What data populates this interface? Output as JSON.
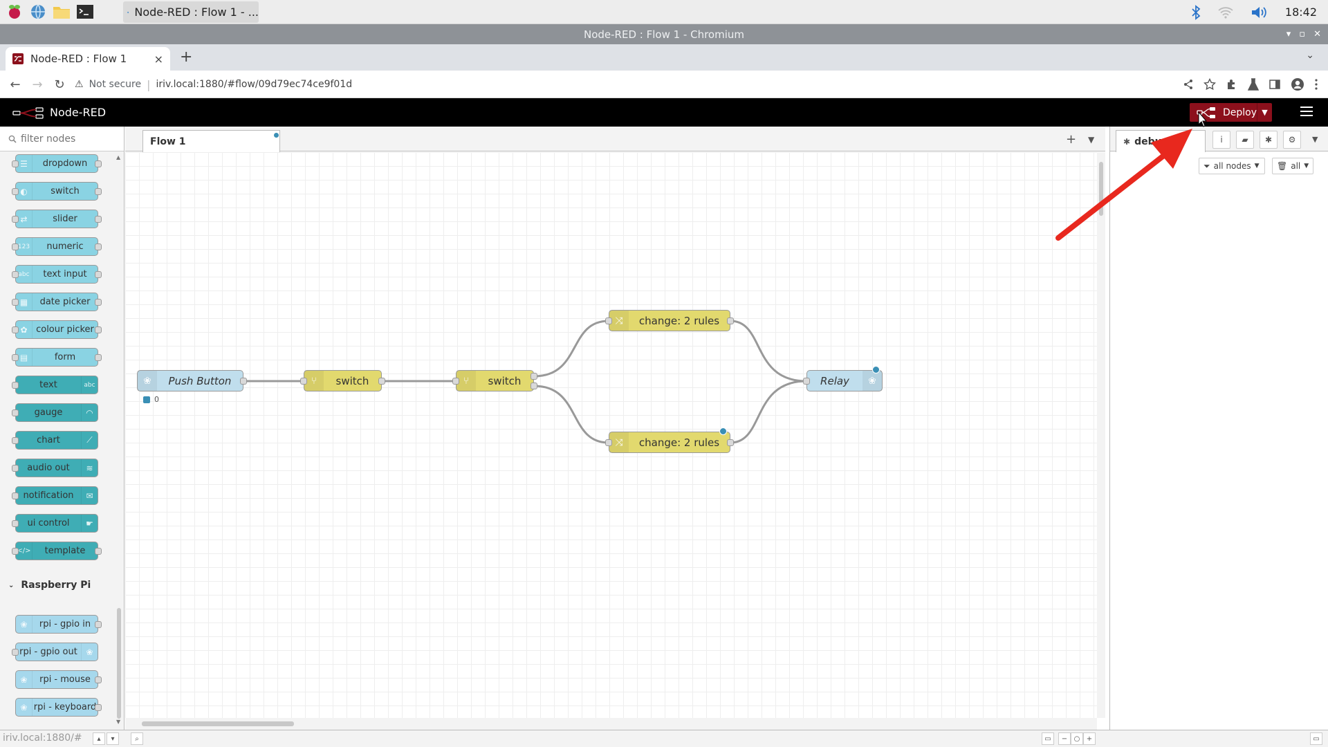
{
  "os": {
    "task_title": "Node-RED : Flow 1 - ...",
    "clock": "18:42",
    "launchers": [
      "raspberry-icon",
      "web-browser-icon",
      "file-manager-icon",
      "terminal-icon"
    ]
  },
  "window": {
    "title": "Node-RED : Flow 1 - Chromium"
  },
  "browser": {
    "tab_title": "Node-RED : Flow 1",
    "tab_close": "×",
    "new_tab": "+",
    "not_secure": "Not secure",
    "url": "iriv.local:1880/#flow/09d79ec74ce9f01d"
  },
  "header": {
    "app_name": "Node-RED",
    "deploy_label": "Deploy"
  },
  "palette": {
    "filter_placeholder": "filter nodes",
    "dashboard_nodes": [
      {
        "label": "dropdown"
      },
      {
        "label": "switch"
      },
      {
        "label": "slider"
      },
      {
        "label": "numeric"
      },
      {
        "label": "text input"
      },
      {
        "label": "date picker"
      },
      {
        "label": "colour picker"
      },
      {
        "label": "form"
      },
      {
        "label": "text"
      },
      {
        "label": "gauge"
      },
      {
        "label": "chart"
      },
      {
        "label": "audio out"
      },
      {
        "label": "notification"
      },
      {
        "label": "ui control"
      },
      {
        "label": "template"
      }
    ],
    "category_rpi": "Raspberry Pi",
    "rpi_nodes": [
      {
        "label": "rpi - gpio in"
      },
      {
        "label": "rpi - gpio out"
      },
      {
        "label": "rpi - mouse"
      },
      {
        "label": "rpi - keyboard"
      }
    ]
  },
  "workspace": {
    "tab_label": "Flow 1",
    "add_tab": "+",
    "nodes": {
      "push_button": "Push Button",
      "switch1": "switch",
      "switch2": "switch",
      "change_top": "change: 2 rules",
      "change_bottom": "change: 2 rules",
      "relay": "Relay"
    },
    "push_button_status": "0"
  },
  "sidebar": {
    "tab_label": "debug",
    "filter_label": "all nodes",
    "clear_label": "all"
  },
  "status_bar": {
    "url": "iriv.local:1880/#"
  },
  "colors": {
    "deploy_red": "#8c101c",
    "change_yellow": "#e2d96e",
    "dashboard_blue": "#8ad3e3",
    "rpi_blue": "#c0deed",
    "annotation_red": "#e8281e"
  }
}
